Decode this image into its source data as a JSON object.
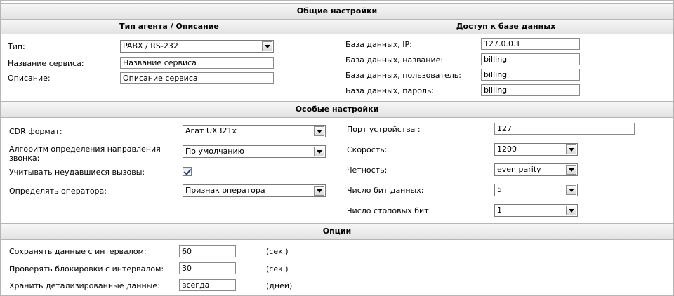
{
  "general": {
    "title": "Общие настройки",
    "agent": {
      "title": "Тип агента / Описание",
      "type_label": "Тип:",
      "type_value": "PABX / RS-232",
      "service_name_label": "Название сервиса:",
      "service_name_value": "Название сервиса",
      "description_label": "Описание:",
      "description_value": "Описание сервиса"
    },
    "db": {
      "title": "Доступ к базе данных",
      "ip_label": "База данных, IP:",
      "ip_value": "127.0.0.1",
      "name_label": "База данных, название:",
      "name_value": "billing",
      "user_label": "База данных, пользователь:",
      "user_value": "billing",
      "password_label": "База данных, пароль:",
      "password_value": "billing"
    }
  },
  "special": {
    "title": "Особые настройки",
    "cdr_label": "CDR формат:",
    "cdr_value": "Агат UX321x",
    "direction_label": "Алгоритм определения направления звонка:",
    "direction_value": "По умолчанию",
    "failed_calls_label": "Учитывать неудавшиеся вызовы:",
    "failed_calls_checked": true,
    "operator_label": "Определять оператора:",
    "operator_value": "Признак оператора",
    "port_label": "Порт устройства :",
    "port_value": "127",
    "speed_label": "Скорость:",
    "speed_value": "1200",
    "parity_label": "Четность:",
    "parity_value": "even parity",
    "data_bits_label": "Число бит данных:",
    "data_bits_value": "5",
    "stop_bits_label": "Число стоповых бит:",
    "stop_bits_value": "1"
  },
  "options": {
    "title": "Опции",
    "save_label": "Сохранять данные с интервалом:",
    "save_value": "60",
    "save_unit": "(сек.)",
    "locks_label": "Проверять блокировки с интервалом:",
    "locks_value": "30",
    "locks_unit": "(сек.)",
    "keep_label": "Хранить детализированные данные:",
    "keep_value": "всегда",
    "keep_unit": "(дней)"
  }
}
